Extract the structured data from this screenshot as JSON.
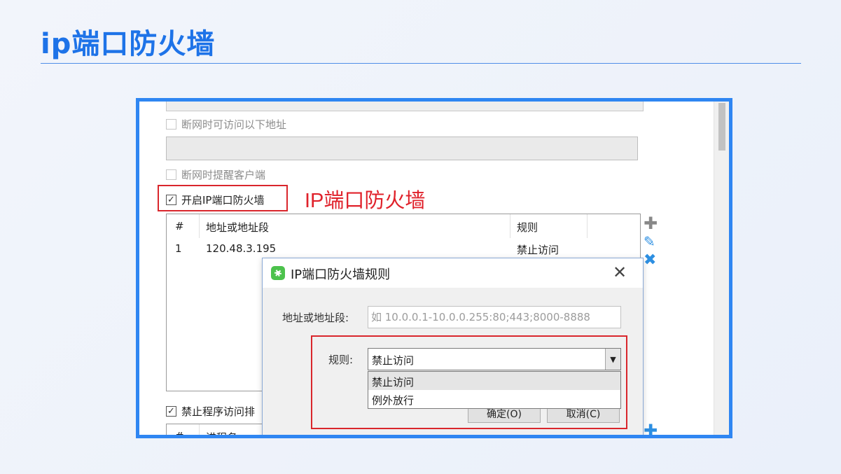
{
  "slide": {
    "title": "ip端口防火墙"
  },
  "settings": {
    "cb_access_addresses": {
      "label": "断网时可访问以下地址",
      "checked": false
    },
    "cb_remind_client": {
      "label": "断网时提醒客户端",
      "checked": false
    },
    "cb_ip_firewall": {
      "label": "开启IP端口防火墙",
      "checked": true
    },
    "cb_block_programs": {
      "label": "禁止程序访问排",
      "checked": true
    },
    "annotation": "IP端口防火墙"
  },
  "firewall_table": {
    "headers": {
      "num": "#",
      "address": "地址或地址段",
      "rule": "规则"
    },
    "rows": [
      {
        "num": "1",
        "address": "120.48.3.195",
        "rule": "禁止访问"
      }
    ]
  },
  "program_table": {
    "headers": {
      "num": "#",
      "name": "进程名"
    }
  },
  "dialog": {
    "title": "IP端口防火墙规则",
    "address_label": "地址或地址段:",
    "address_placeholder": "如 10.0.0.1-10.0.0.255:80;443;8000-8888",
    "rule_label": "规则:",
    "rule_value": "禁止访问",
    "rule_options": [
      "禁止访问",
      "例外放行"
    ],
    "ok_label": "确定(O)",
    "cancel_label": "取消(C)"
  },
  "icons": {
    "add": "plus-icon",
    "edit": "pencil-icon",
    "delete": "x-icon",
    "close": "close-icon",
    "dropdown": "chevron-down-icon",
    "check": "checkmark-icon"
  },
  "colors": {
    "title": "#1e73e8",
    "frame": "#2f86f2",
    "highlight": "#d9262c",
    "icon_blue": "#2d8fe2"
  }
}
